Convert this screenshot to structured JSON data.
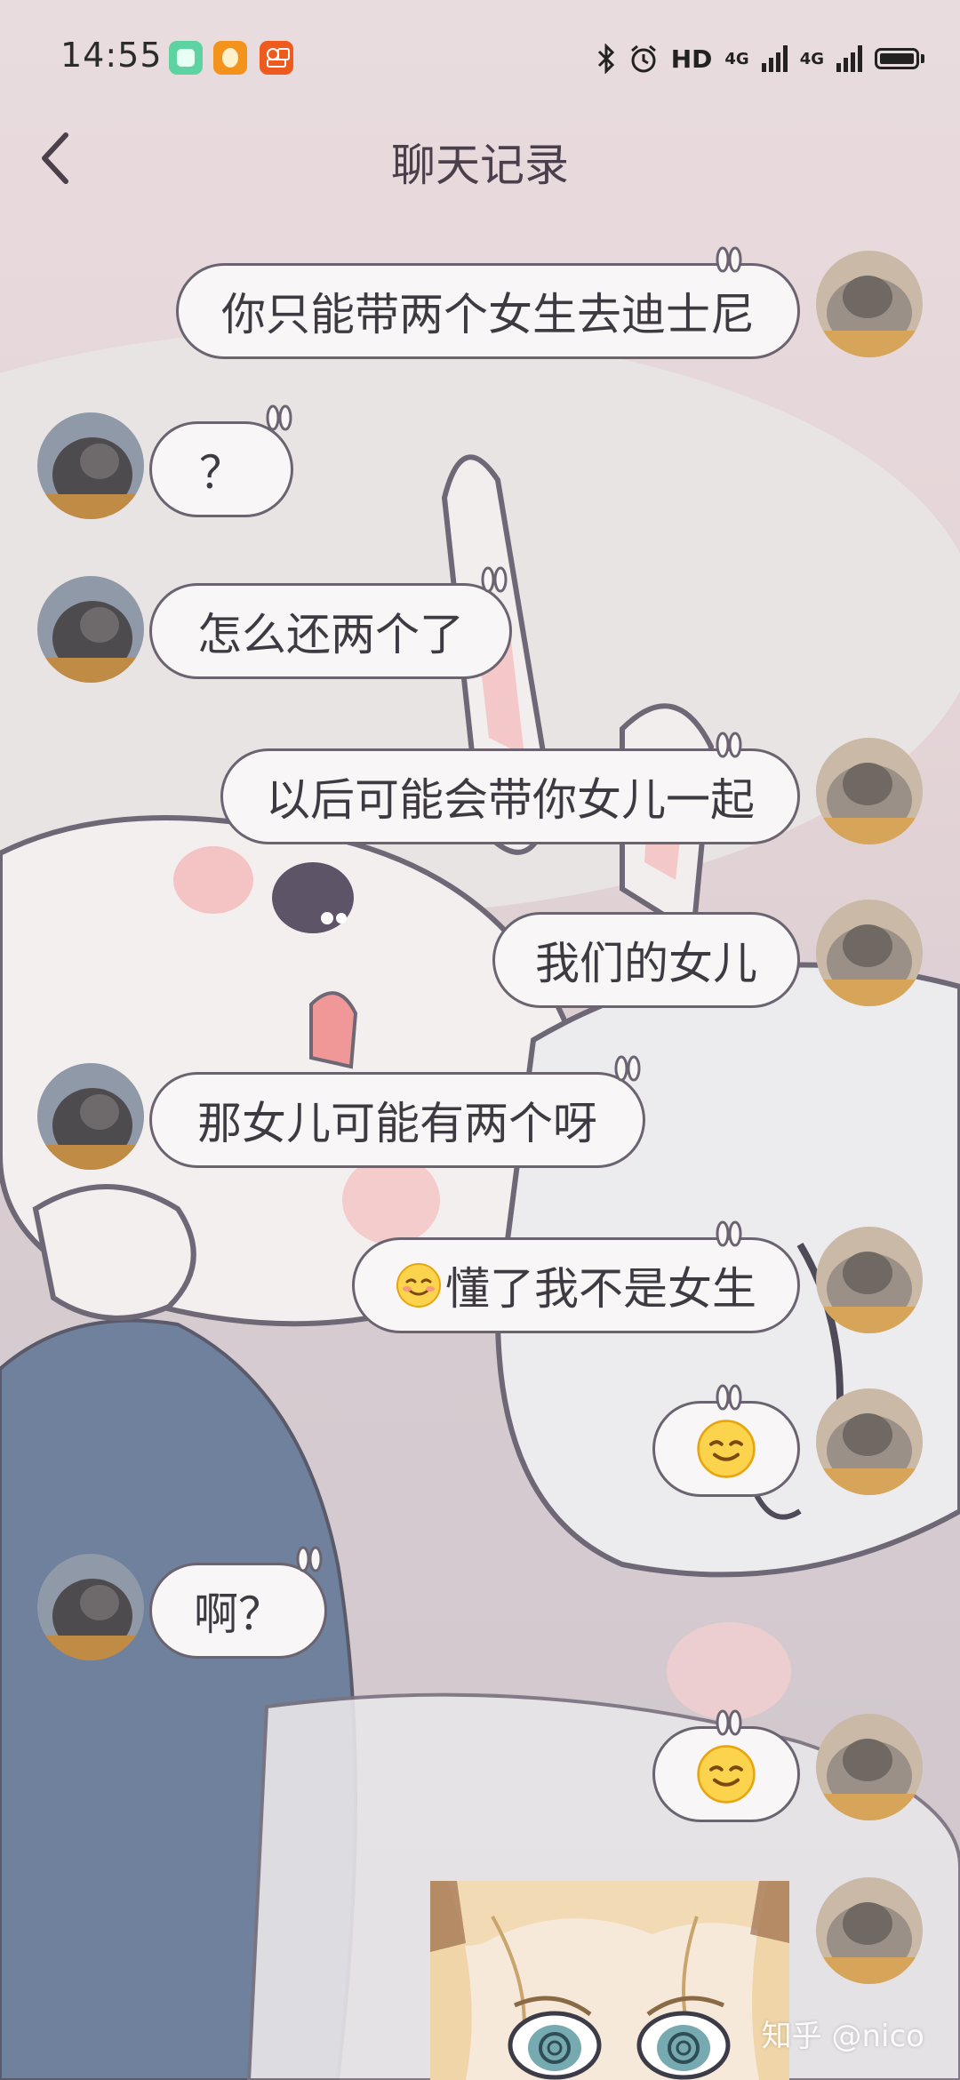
{
  "status_bar": {
    "time": "14:55",
    "hd_label": "HD",
    "network_1": "4G",
    "network_2": "4G",
    "icons": [
      "app-icon-green",
      "app-icon-orange",
      "app-icon-orange-grid",
      "bluetooth-icon",
      "alarm-icon",
      "signal-icon",
      "battery-icon"
    ]
  },
  "header": {
    "title": "聊天记录",
    "back_icon": "chevron-left-icon"
  },
  "messages": [
    {
      "side": "right",
      "text": "你只能带两个女生去迪士尼"
    },
    {
      "side": "left",
      "text": "？"
    },
    {
      "side": "left",
      "text": "怎么还两个了"
    },
    {
      "side": "right",
      "text": "以后可能会带你女儿一起"
    },
    {
      "side": "right",
      "text": "我们的女儿"
    },
    {
      "side": "left",
      "text": "那女儿可能有两个呀"
    },
    {
      "side": "right",
      "emoji": "relieved-face-emoji",
      "text": "懂了我不是女生"
    },
    {
      "side": "right",
      "emoji": "smiling-face-emoji",
      "text": ""
    },
    {
      "side": "left",
      "text": "啊？"
    },
    {
      "side": "right",
      "emoji": "smiling-face-emoji",
      "text": ""
    },
    {
      "side": "right",
      "image": "anime-girl-sticker",
      "text": ""
    }
  ],
  "watermark": "知乎 @nico",
  "colors": {
    "bubble_fill": "#f8f6f7",
    "bubble_border": "#6b6470",
    "title_color": "#4a3f4a",
    "background": "#e6d8db"
  }
}
